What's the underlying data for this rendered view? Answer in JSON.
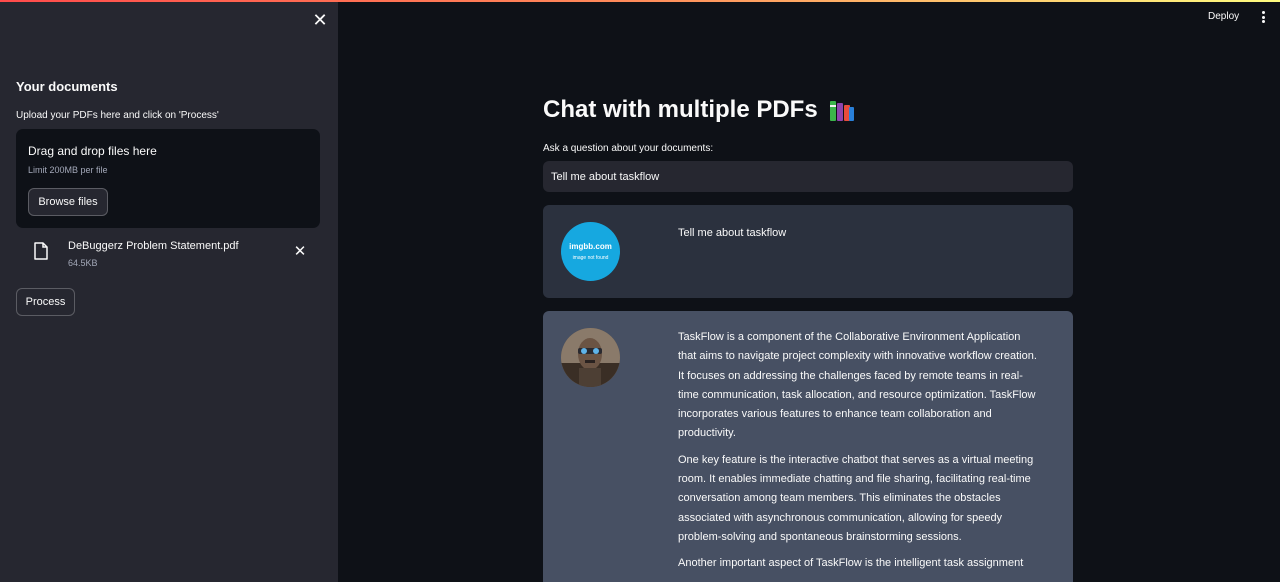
{
  "sidebar": {
    "title": "Your documents",
    "upload_label": "Upload your PDFs here and click on 'Process'",
    "dropzone_title": "Drag and drop files here",
    "dropzone_limit": "Limit 200MB per file",
    "browse_label": "Browse files",
    "file": {
      "name": "DeBuggerz Problem Statement.pdf",
      "size": "64.5KB"
    },
    "process_label": "Process"
  },
  "header": {
    "deploy_label": "Deploy"
  },
  "main": {
    "title": "Chat with multiple PDFs",
    "question_label": "Ask a question about your documents:",
    "question_value": "Tell me about taskflow",
    "user_message": {
      "avatar_title": "imgbb.com",
      "avatar_subtitle": "image not found",
      "text": "Tell me about taskflow"
    },
    "bot_message": {
      "para1": "TaskFlow is a component of the Collaborative Environment Application that aims to navigate project complexity with innovative workflow creation. It focuses on addressing the challenges faced by remote teams in real-time communication, task allocation, and resource optimization. TaskFlow incorporates various features to enhance team collaboration and productivity.",
      "para2": "One key feature is the interactive chatbot that serves as a virtual meeting room. It enables immediate chatting and file sharing, facilitating real-time conversation among team members. This eliminates the obstacles associated with asynchronous communication, allowing for speedy problem-solving and spontaneous brainstorming sessions.",
      "para3": "Another important aspect of TaskFlow is the intelligent task assignment"
    }
  },
  "colors": {
    "app_bg": "#0e1117",
    "sidebar_bg": "#262730",
    "user_msg_bg": "#2b313e",
    "bot_msg_bg": "#475063",
    "imgbb_blue": "#16a8e0"
  },
  "icons": [
    "close-icon",
    "file-icon",
    "remove-file-icon",
    "kebab-menu-icon",
    "books-icon"
  ]
}
